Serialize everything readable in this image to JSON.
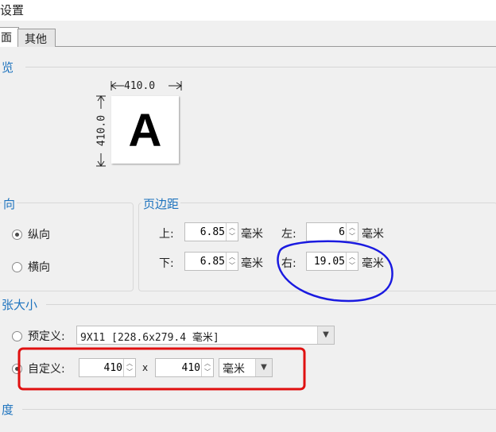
{
  "window": {
    "title": "设置"
  },
  "tabs": [
    {
      "label": "面"
    },
    {
      "label": "其他"
    }
  ],
  "preview": {
    "section_title": "览",
    "width_label": "410.0",
    "height_label": "410.0",
    "letter": "A"
  },
  "orientation": {
    "section_title": "向",
    "options": [
      {
        "label": "纵向",
        "checked": true
      },
      {
        "label": "横向",
        "checked": false
      }
    ]
  },
  "margins": {
    "section_title": "页边距",
    "top": {
      "label": "上:",
      "value": "6.85",
      "unit": "毫米"
    },
    "left": {
      "label": "左:",
      "value": "6",
      "unit": "毫米"
    },
    "bottom": {
      "label": "下:",
      "value": "6.85",
      "unit": "毫米"
    },
    "right": {
      "label": "右:",
      "value": "19.05",
      "unit": "毫米"
    }
  },
  "paper_size": {
    "section_title": "张大小",
    "predefined": {
      "label": "预定义:",
      "value": "9X11 [228.6x279.4 毫米]",
      "checked": false
    },
    "custom": {
      "label": "自定义:",
      "width": "410",
      "separator": "x",
      "height": "410",
      "unit": "毫米",
      "checked": true
    }
  },
  "next_section": {
    "section_title": "度"
  },
  "annotations": {
    "circle_color": "#1a1ae0",
    "rect_color": "#e01010"
  }
}
